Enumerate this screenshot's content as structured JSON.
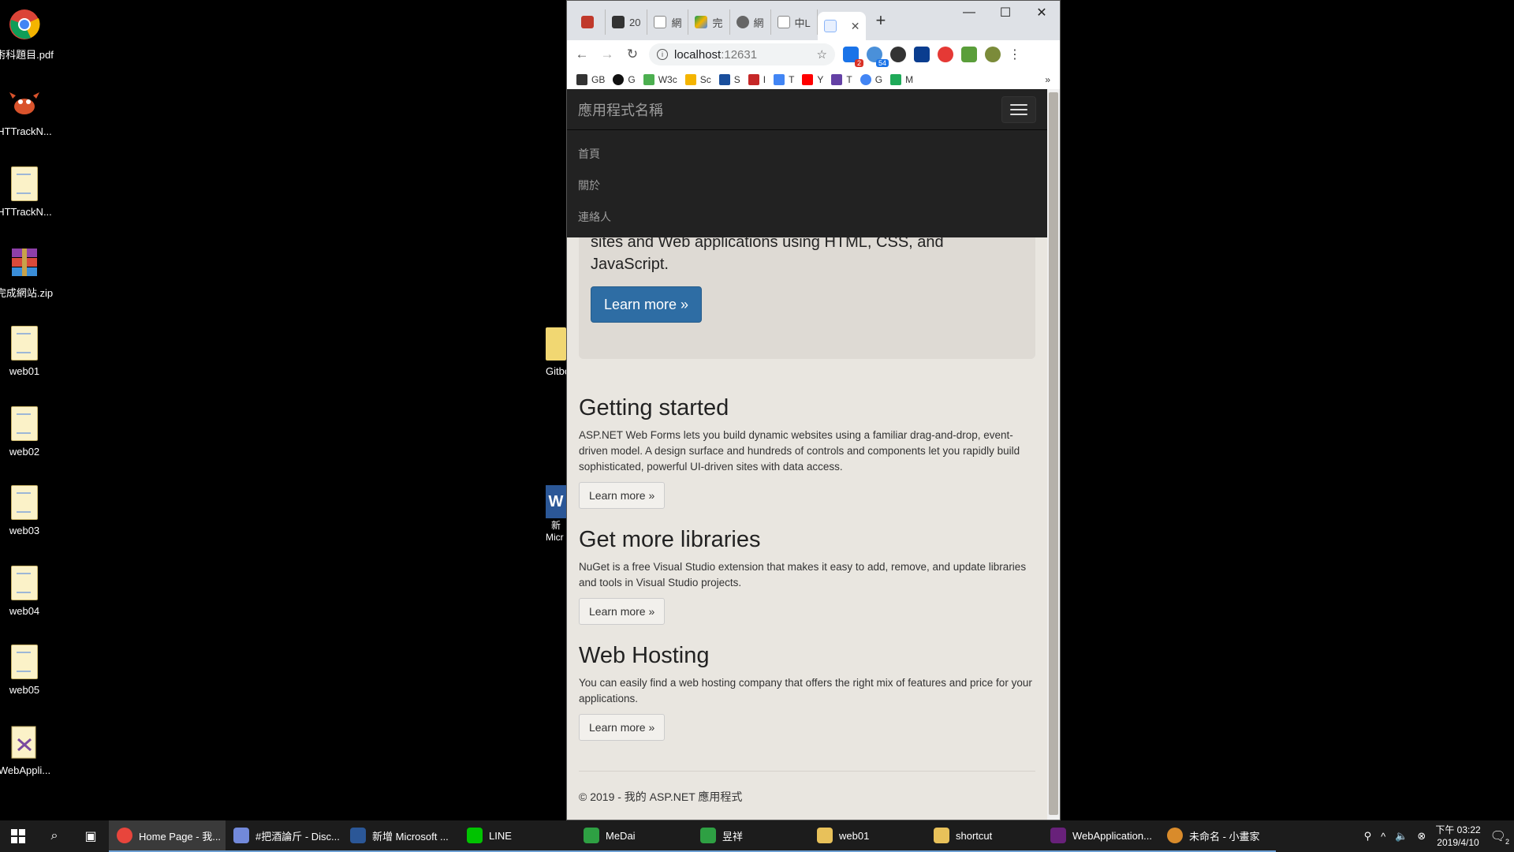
{
  "desktop": {
    "icons": [
      {
        "label": "術科題目.pdf"
      },
      {
        "label": "HTTrackN..."
      },
      {
        "label": "HTTrackN..."
      },
      {
        "label": "完成網站.zip"
      },
      {
        "label": "web01"
      },
      {
        "label": "web02"
      },
      {
        "label": "web03"
      },
      {
        "label": "web04"
      },
      {
        "label": "web05"
      },
      {
        "label": "WebAppli..."
      }
    ],
    "partial_labels": [
      "Gitbo",
      "新",
      "Micr"
    ]
  },
  "browser": {
    "tabs": [
      {
        "label": ""
      },
      {
        "label": "20"
      },
      {
        "label": "網"
      },
      {
        "label": "完"
      },
      {
        "label": "網"
      },
      {
        "label": "中L"
      },
      {
        "label": ""
      }
    ],
    "new_tab": "+",
    "url_host": "localhost",
    "url_port": ":12631",
    "extension_badges": [
      "2",
      "54"
    ],
    "bookmarks": [
      "GB",
      "G",
      "W3c",
      "Sc",
      "S",
      "I",
      "T",
      "Y",
      "T",
      "G",
      "M"
    ],
    "bookmarks_more": "»"
  },
  "page": {
    "navbar": {
      "brand": "應用程式名稱",
      "links": [
        "首頁",
        "關於",
        "連絡人"
      ]
    },
    "jumbotron": {
      "lead": "sites and Web applications using HTML, CSS, and JavaScript.",
      "button": "Learn more »"
    },
    "sections": [
      {
        "title": "Getting started",
        "text": "ASP.NET Web Forms lets you build dynamic websites using a familiar drag-and-drop, event-driven model. A design surface and hundreds of controls and components let you rapidly build sophisticated, powerful UI-driven sites with data access.",
        "button": "Learn more »"
      },
      {
        "title": "Get more libraries",
        "text": "NuGet is a free Visual Studio extension that makes it easy to add, remove, and update libraries and tools in Visual Studio projects.",
        "button": "Learn more »"
      },
      {
        "title": "Web Hosting",
        "text": "You can easily find a web hosting company that offers the right mix of features and price for your applications.",
        "button": "Learn more »"
      }
    ],
    "footer": "© 2019 - 我的 ASP.NET 應用程式"
  },
  "taskbar": {
    "apps": [
      {
        "label": "Home Page - 我...",
        "color": "#e8453c"
      },
      {
        "label": "#把酒論斤 - Disc...",
        "color": "#7289da"
      },
      {
        "label": "新增 Microsoft ...",
        "color": "#2b5797"
      },
      {
        "label": "LINE",
        "color": "#00c300"
      },
      {
        "label": "MeDai",
        "color": "#2ea043"
      },
      {
        "label": "昱祥",
        "color": "#2ea043"
      },
      {
        "label": "web01",
        "color": "#e8c15a"
      },
      {
        "label": "shortcut",
        "color": "#e8c15a"
      },
      {
        "label": "WebApplication...",
        "color": "#68217a"
      },
      {
        "label": "未命名 - 小畫家",
        "color": "#d98b2b"
      }
    ],
    "time": "下午 03:22",
    "date": "2019/4/10",
    "notifications": "2"
  }
}
